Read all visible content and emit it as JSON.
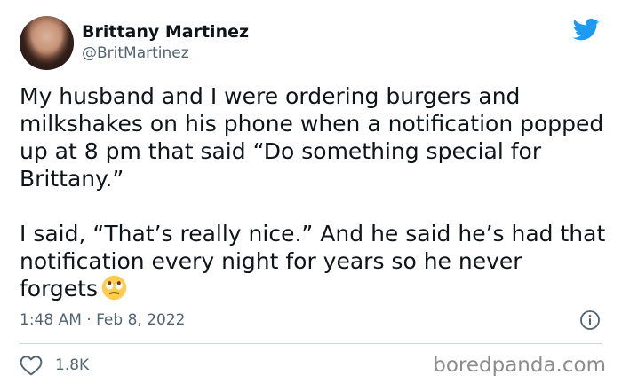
{
  "author": {
    "display_name": "Brittany Martinez",
    "handle": "@BritMartinez"
  },
  "tweet": {
    "paragraphs": [
      "My husband and I were ordering burgers and milkshakes on his phone when a notification popped up at 8 pm that said “Do something special for Brittany.”",
      "I said, “That’s really nice.” And he said he’s had that notification every night for years so he never forgets"
    ],
    "emoji": "face-with-rolling-eyes",
    "timestamp": "1:48 AM · Feb 8, 2022"
  },
  "stats": {
    "likes": "1.8K"
  },
  "watermark": "boredpanda.com",
  "colors": {
    "brand_blue": "#1d9bf0",
    "secondary_text": "#536471",
    "divider": "#cfd9de"
  },
  "icons": {
    "brand": "twitter-bird-icon",
    "info": "info-icon",
    "like": "heart-icon"
  }
}
